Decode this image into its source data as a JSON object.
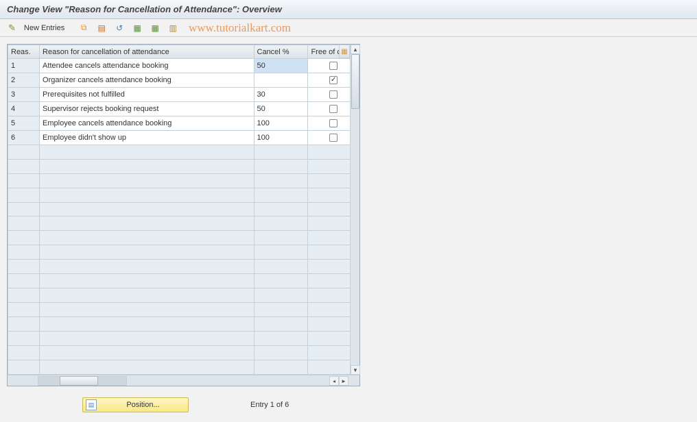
{
  "title": "Change View \"Reason for Cancellation of Attendance\": Overview",
  "toolbar": {
    "new_entries": "New Entries"
  },
  "watermark": "www.tutorialkart.com",
  "table": {
    "headers": {
      "reas": "Reas.",
      "reason": "Reason for cancellation of attendance",
      "cancel": "Cancel %",
      "free": "Free of ch"
    },
    "rows": [
      {
        "reas": "1",
        "reason": "Attendee cancels attendance booking",
        "cancel": "50",
        "free": false,
        "selected": true
      },
      {
        "reas": "2",
        "reason": "Organizer cancels attendance booking",
        "cancel": "",
        "free": true,
        "selected": false
      },
      {
        "reas": "3",
        "reason": "Prerequisites not fulfilled",
        "cancel": "30",
        "free": false,
        "selected": false
      },
      {
        "reas": "4",
        "reason": "Supervisor rejects booking request",
        "cancel": "50",
        "free": false,
        "selected": false
      },
      {
        "reas": "5",
        "reason": "Employee cancels attendance booking",
        "cancel": "100",
        "free": false,
        "selected": false
      },
      {
        "reas": "6",
        "reason": "Employee didn't show up",
        "cancel": "100",
        "free": false,
        "selected": false
      }
    ],
    "empty_rows": 16
  },
  "footer": {
    "position_label": "Position...",
    "entry_text": "Entry 1 of 6"
  }
}
